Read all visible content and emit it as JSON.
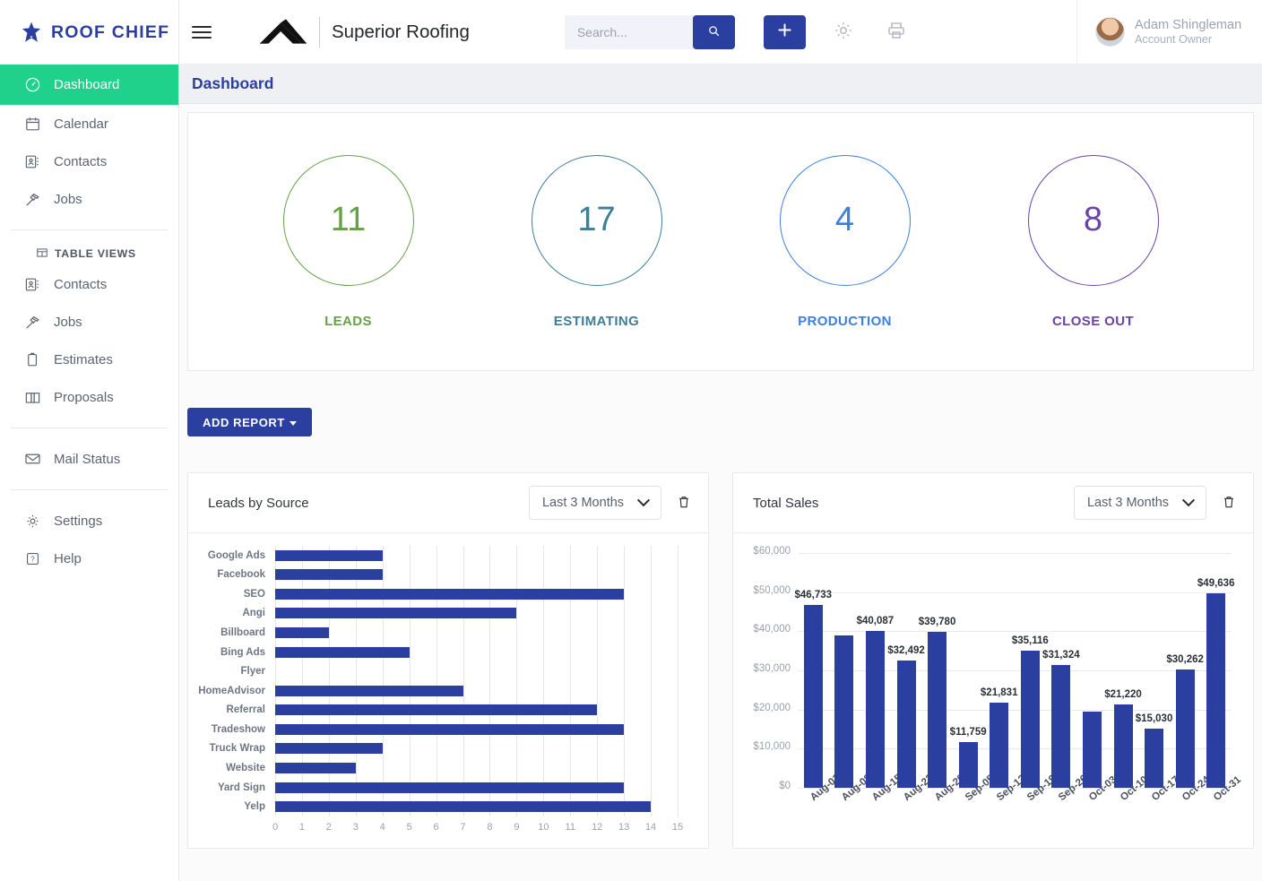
{
  "brand": {
    "name": "ROOF CHIEF",
    "icon": "star-icon"
  },
  "sidebar": {
    "primary": [
      {
        "label": "Dashboard",
        "icon": "gauge-icon",
        "active": true
      },
      {
        "label": "Calendar",
        "icon": "calendar-icon",
        "active": false
      },
      {
        "label": "Contacts",
        "icon": "contact-card-icon",
        "active": false
      },
      {
        "label": "Jobs",
        "icon": "hammer-icon",
        "active": false
      }
    ],
    "table_views_label": "TABLE VIEWS",
    "table_views_icon": "table-icon",
    "table_views": [
      {
        "label": "Contacts",
        "icon": "contact-card-icon"
      },
      {
        "label": "Jobs",
        "icon": "hammer-icon"
      },
      {
        "label": "Estimates",
        "icon": "clipboard-icon"
      },
      {
        "label": "Proposals",
        "icon": "book-icon"
      }
    ],
    "mail": [
      {
        "label": "Mail Status",
        "icon": "envelope-icon"
      }
    ],
    "bottom": [
      {
        "label": "Settings",
        "icon": "gear-icon"
      },
      {
        "label": "Help",
        "icon": "question-icon"
      }
    ]
  },
  "topbar": {
    "org_name": "Superior Roofing",
    "org_logo_icon": "roof-peak-icon",
    "menu_icon": "hamburger-icon",
    "search": {
      "placeholder": "Search...",
      "value": "",
      "button_icon": "search-icon"
    },
    "add_button_label": "+",
    "settings_icon": "gear-icon",
    "print_icon": "printer-icon",
    "user": {
      "name": "Adam Shingleman",
      "role": "Account Owner",
      "avatar": "user-avatar"
    }
  },
  "page": {
    "title": "Dashboard"
  },
  "kpis": [
    {
      "value": "11",
      "label": "LEADS",
      "color": "#65a247"
    },
    {
      "value": "17",
      "label": "ESTIMATING",
      "color": "#3d7f98"
    },
    {
      "value": "4",
      "label": "PRODUCTION",
      "color": "#3d7fe0"
    },
    {
      "value": "8",
      "label": "CLOSE OUT",
      "color": "#6b42a8"
    }
  ],
  "toolbar": {
    "add_report_label": "ADD REPORT"
  },
  "reports": [
    {
      "title": "Leads by Source",
      "range_value": "Last 3 Months",
      "delete_icon": "trash-icon",
      "chevron_icon": "chevron-down-icon"
    },
    {
      "title": "Total Sales",
      "range_value": "Last 3 Months",
      "delete_icon": "trash-icon",
      "chevron_icon": "chevron-down-icon"
    }
  ],
  "chart_data": [
    {
      "type": "bar",
      "orientation": "horizontal",
      "title": "Leads by Source",
      "xlabel": "",
      "ylabel": "",
      "xlim": [
        0,
        15
      ],
      "grid": true,
      "bar_color": "#2a3fa0",
      "categories": [
        "Google Ads",
        "Facebook",
        "SEO",
        "Angi",
        "Billboard",
        "Bing Ads",
        "Flyer",
        "HomeAdvisor",
        "Referral",
        "Tradeshow",
        "Truck Wrap",
        "Website",
        "Yard Sign",
        "Yelp"
      ],
      "values": [
        4,
        4,
        13,
        9,
        2,
        5,
        0,
        7,
        12,
        13,
        4,
        3,
        13,
        14
      ],
      "xticks": [
        "0",
        "1",
        "2",
        "3",
        "4",
        "5",
        "6",
        "7",
        "8",
        "9",
        "10",
        "11",
        "12",
        "13",
        "14",
        "15"
      ]
    },
    {
      "type": "bar",
      "orientation": "vertical",
      "title": "Total Sales",
      "xlabel": "",
      "ylabel": "",
      "ylim": [
        0,
        60000
      ],
      "grid": true,
      "bar_color": "#2a3fa0",
      "categories": [
        "Aug-01",
        "Aug-08",
        "Aug-15",
        "Aug-22",
        "Aug-29",
        "Sep-05",
        "Sep-12",
        "Sep-19",
        "Sep-26",
        "Oct-03",
        "Oct-10",
        "Oct-17",
        "Oct-24",
        "Oct-31"
      ],
      "values": [
        46733,
        38900,
        40087,
        32492,
        39780,
        11759,
        21831,
        35116,
        31324,
        19500,
        21220,
        15030,
        30262,
        49636
      ],
      "data_labels": [
        "$46,733",
        "",
        "$40,087",
        "$32,492",
        "$39,780",
        "$11,759",
        "$21,831",
        "$35,116",
        "$31,324",
        "",
        "$21,220",
        "$15,030",
        "$30,262",
        "$49,636"
      ],
      "yticks": [
        "$0",
        "$10,000",
        "$20,000",
        "$30,000",
        "$40,000",
        "$50,000",
        "$60,000"
      ],
      "ytick_values": [
        0,
        10000,
        20000,
        30000,
        40000,
        50000,
        60000
      ]
    }
  ]
}
